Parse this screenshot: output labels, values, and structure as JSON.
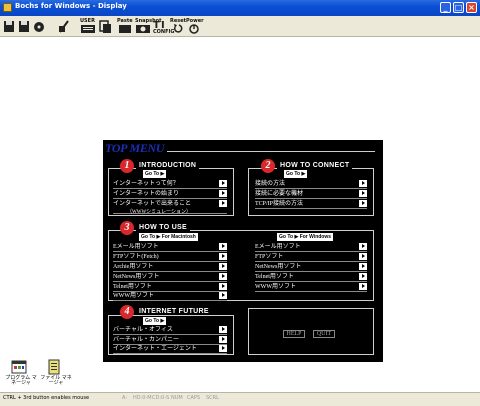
{
  "window": {
    "title": "Bochs for Windows - Display",
    "minimize": "_",
    "maximize": "□",
    "close": "×"
  },
  "toolbar": [
    {
      "name": "floppy-a-icon",
      "label": ""
    },
    {
      "name": "floppy-b-icon",
      "label": ""
    },
    {
      "name": "cdrom-icon",
      "label": ""
    },
    {
      "name": "mouse-icon",
      "label": ""
    },
    {
      "name": "user-icon",
      "label": "USER"
    },
    {
      "name": "copy-icon",
      "label": ""
    },
    {
      "name": "paste-icon",
      "label": "Paste"
    },
    {
      "name": "snapshot-icon",
      "label": "Snapshot"
    },
    {
      "name": "config-icon",
      "label": "CONFIG"
    },
    {
      "name": "reset-icon",
      "label": "Reset"
    },
    {
      "name": "power-icon",
      "label": "Power"
    }
  ],
  "menu": {
    "title": "TOP MENU",
    "sections": {
      "intro": {
        "num": "1",
        "title": "INTRODUCTION",
        "goto": "Go To",
        "items": [
          "インターネットって何？",
          "インターネットの始まり",
          "インターネットで出来ること"
        ],
        "sub": "（WWWシミュレーション）"
      },
      "connect": {
        "num": "2",
        "title": "HOW TO CONNECT",
        "goto": "Go To",
        "items": [
          "接続の方法",
          "接続に必要な機材",
          "TCP/IP接続の方法"
        ]
      },
      "use": {
        "num": "3",
        "title": "HOW TO USE",
        "goto_mac": "Go To  ▶  For Macintosh",
        "goto_win": "Go To  ▶  For Windows",
        "mac_items": [
          "Eメール用ソフト",
          "FTPソフト(Fetch)",
          "Archie用ソフト",
          "NetNews用ソフト",
          "Telnet用ソフト",
          "WWW用ソフト"
        ],
        "win_items": [
          "Eメール用ソフト",
          "FTPソフト",
          "NetNews用ソフト",
          "Telnet用ソフト",
          "WWW用ソフト"
        ]
      },
      "future": {
        "num": "4",
        "title": "INTERNET FUTURE",
        "goto": "Go To",
        "items": [
          "バーチャル・オフィス",
          "バーチャル・カンパニー",
          "インターネット・エージェント"
        ]
      }
    },
    "help": "HELP",
    "quit": "QUIT"
  },
  "desktop_icons": [
    {
      "label": "プログラム マネージャ"
    },
    {
      "label": "ファイル マネージャ"
    }
  ],
  "status": {
    "text": "CTRL + 3rd button enables mouse",
    "fields": [
      "A:",
      "HD:0-M",
      "CD:0-S",
      "NUM",
      "CAPS",
      "SCRL"
    ]
  }
}
